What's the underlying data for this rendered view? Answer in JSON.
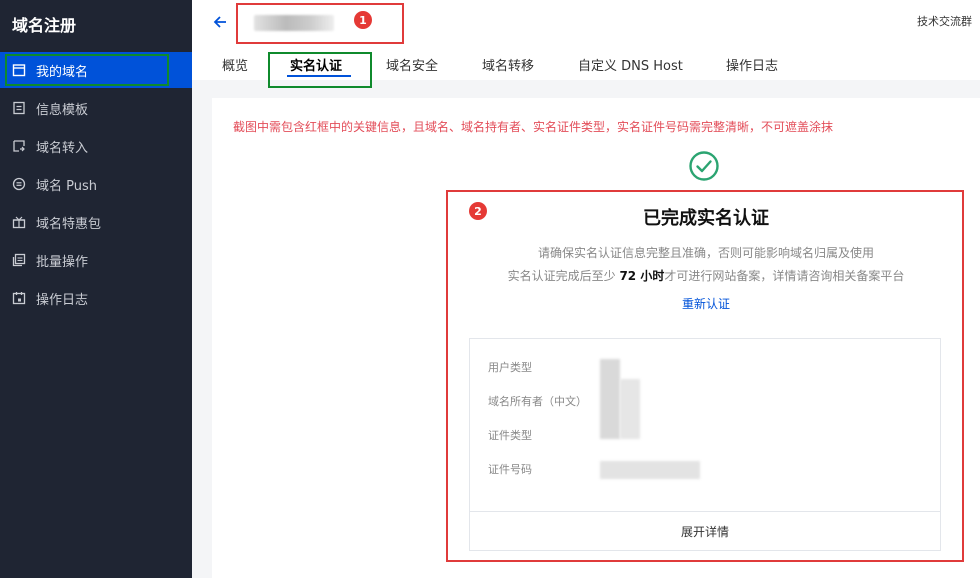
{
  "sidebar": {
    "title": "域名注册",
    "items": [
      {
        "label": "我的域名",
        "icon": "calendar-icon",
        "active": true
      },
      {
        "label": "信息模板",
        "icon": "document-icon"
      },
      {
        "label": "域名转入",
        "icon": "transfer-in-icon"
      },
      {
        "label": "域名 Push",
        "icon": "push-icon"
      },
      {
        "label": "域名特惠包",
        "icon": "gift-icon"
      },
      {
        "label": "批量操作",
        "icon": "batch-icon"
      },
      {
        "label": "操作日志",
        "icon": "log-icon"
      }
    ]
  },
  "header": {
    "right_link": "技术交流群",
    "tabs": [
      "概览",
      "实名认证",
      "域名安全",
      "域名转移",
      "自定义 DNS Host",
      "操作日志"
    ],
    "active_tab": 1
  },
  "annotations": {
    "badge1": "1",
    "badge2": "2"
  },
  "main": {
    "notice": "截图中需包含红框中的关键信息，且域名、域名持有者、实名证件类型，实名证件号码需完整清晰，不可遮盖涂抹",
    "title": "已完成实名认证",
    "desc_line1": "请确保实名认证信息完整且准确，否则可能影响域名归属及使用",
    "desc_line2_pre": "实名认证完成后至少 ",
    "desc_line2_bold": "72 小时",
    "desc_line2_post": "才可进行网站备案，详情请咨询相关备案平台",
    "reverify": "重新认证",
    "fields": [
      "用户类型",
      "域名所有者（中文）",
      "证件类型",
      "证件号码"
    ],
    "expand": "展开详情"
  },
  "colors": {
    "accent": "#0052d9",
    "sidebar_bg": "#1f2533",
    "notice": "#e34d59",
    "success": "#2ba471",
    "annotation_red": "#e03b3b",
    "annotation_green": "#0f8a2c"
  }
}
